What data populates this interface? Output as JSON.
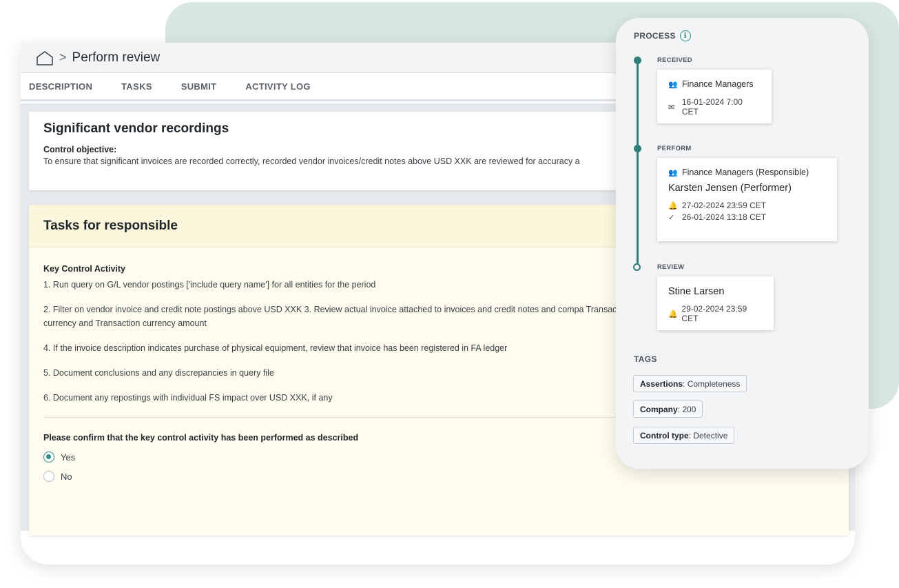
{
  "header": {
    "breadcrumb_sep": ">",
    "title": "Perform review"
  },
  "tabs": [
    "DESCRIPTION",
    "TASKS",
    "SUBMIT",
    "ACTIVITY LOG"
  ],
  "description": {
    "title": "Significant vendor recordings",
    "objective_label": "Control objective:",
    "objective_text": "To ensure that significant invoices are recorded correctly, recorded vendor invoices/credit notes above USD XXK are reviewed for accuracy a"
  },
  "tasks": {
    "title": "Tasks for responsible",
    "activity_label": "Key Control Activity",
    "steps": [
      "1. Run query on G/L vendor postings ['include query name'] for all entities for the period",
      "2. Filter on vendor invoice and credit note postings above USD XXK 3. Review actual invoice attached to invoices and credit notes and compa Transaction currency and Transaction currency amount",
      "4. If the invoice description indicates purchase of physical equipment, review that invoice has been registered in FA ledger",
      "5. Document conclusions and any discrepancies in query file",
      "6. Document any repostings with individual FS impact over USD XXK, if any"
    ],
    "confirm_question": "Please confirm that the key control activity has been performed as described",
    "options": [
      {
        "label": "Yes",
        "selected": true
      },
      {
        "label": "No",
        "selected": false
      }
    ]
  },
  "process": {
    "title": "PROCESS",
    "accent_color": "#2f7e78",
    "stages": {
      "received": {
        "label": "RECEIVED",
        "group": "Finance Managers",
        "date": "16-01-2024 7:00 CET"
      },
      "perform": {
        "label": "PERFORM",
        "group": "Finance Managers (Responsible)",
        "person": "Karsten Jensen (Performer)",
        "deadline": "27-02-2024 23:59 CET",
        "completed": "26-01-2024 13:18 CET"
      },
      "review": {
        "label": "REVIEW",
        "person": "Stine Larsen",
        "deadline": "29-02-2024 23:59 CET"
      }
    }
  },
  "tags": {
    "title": "TAGS",
    "items": [
      {
        "key": "Assertions",
        "value": ": Completeness"
      },
      {
        "key": "Company",
        "value": ": 200"
      },
      {
        "key": "Control type",
        "value": ": Detective"
      }
    ]
  }
}
